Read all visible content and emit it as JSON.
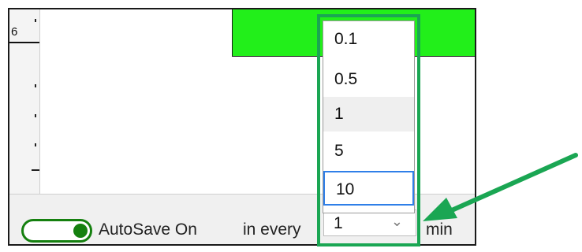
{
  "ruler": {
    "visible_number": "6"
  },
  "statusbar": {
    "autosave_label": "AutoSave On",
    "interval_prefix": "in every",
    "interval_value": "1",
    "interval_unit": "min"
  },
  "dropdown": {
    "options": [
      "0.1",
      "0.5",
      "1",
      "5",
      "10"
    ],
    "selected": "1",
    "hovered": "1",
    "focused": "10"
  },
  "colors": {
    "toggle_on": "#15800f",
    "timeline_block": "#22ef1a",
    "annotation": "#1aa653",
    "focus_border": "#2f7fe8"
  },
  "icons": [
    "chevron-down-icon",
    "pointer-arrow-icon"
  ]
}
